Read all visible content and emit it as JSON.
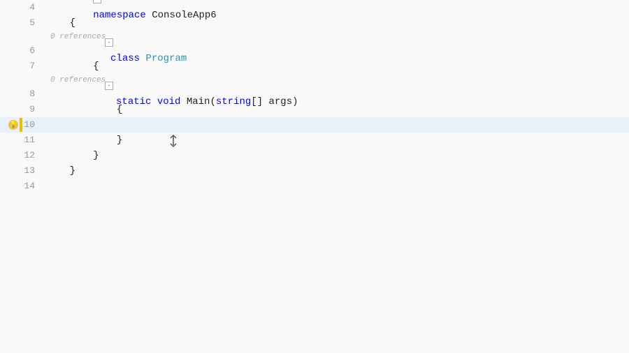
{
  "editor": {
    "background": "#f9f9f9",
    "lines": [
      {
        "number": "4",
        "indent": "",
        "collapse": false,
        "hint": null,
        "content": [
          {
            "type": "collapse-open",
            "id": "ns-collapse"
          },
          {
            "type": "keyword",
            "text": "namespace "
          },
          {
            "type": "normal",
            "text": "ConsoleApp6"
          }
        ]
      },
      {
        "number": "5",
        "hint": null,
        "content": [
          {
            "type": "normal",
            "text": "    {"
          }
        ]
      },
      {
        "number": "6",
        "hint": "0 references",
        "content": [
          {
            "type": "collapse-open",
            "id": "class-collapse"
          },
          {
            "type": "keyword",
            "text": "class "
          },
          {
            "type": "classname",
            "text": "Program"
          }
        ],
        "indent": "        "
      },
      {
        "number": "7",
        "hint": null,
        "content": [
          {
            "type": "normal",
            "text": "        {"
          }
        ]
      },
      {
        "number": "8",
        "hint": "0 references",
        "content": [
          {
            "type": "collapse-open",
            "id": "method-collapse"
          },
          {
            "type": "keyword",
            "text": "static "
          },
          {
            "type": "keyword",
            "text": "void "
          },
          {
            "type": "normal",
            "text": "Main("
          },
          {
            "type": "keyword",
            "text": "string"
          },
          {
            "type": "normal",
            "text": "[] args)"
          }
        ],
        "indent": "            "
      },
      {
        "number": "9",
        "hint": null,
        "content": [
          {
            "type": "normal",
            "text": "            {"
          }
        ]
      },
      {
        "number": "10",
        "hint": null,
        "highlighted": true,
        "content": [],
        "hasLightbulb": true,
        "hasYellowBar": true
      },
      {
        "number": "11",
        "hint": null,
        "content": [
          {
            "type": "normal",
            "text": "            }"
          }
        ]
      },
      {
        "number": "12",
        "hint": null,
        "content": [
          {
            "type": "normal",
            "text": "        }"
          }
        ]
      },
      {
        "number": "13",
        "hint": null,
        "content": [
          {
            "type": "normal",
            "text": "    }"
          }
        ]
      },
      {
        "number": "14",
        "hint": null,
        "content": []
      }
    ]
  }
}
